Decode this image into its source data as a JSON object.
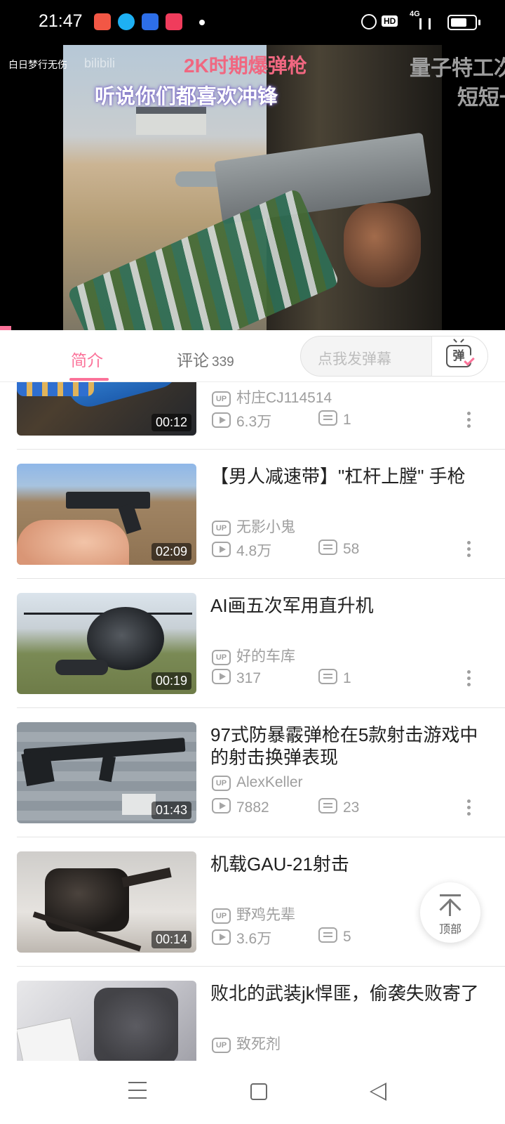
{
  "status_bar": {
    "time": "21:47",
    "network_label": "4G",
    "hd_label": "HD"
  },
  "player": {
    "caption_top": "2K时期爆弹枪",
    "caption_sub": "听说你们都喜欢冲锋",
    "danmaku_left": "白日梦行无伤",
    "watermark": "bilibili",
    "danmaku_right_1": "量子特工次",
    "danmaku_right_2": "短短一"
  },
  "tabs": {
    "intro": "简介",
    "comments": "评论",
    "comments_count": "339",
    "danmaku_placeholder": "点我发弹幕",
    "danmaku_button": "弹"
  },
  "videos": [
    {
      "title": "",
      "uploader": "村庄CJ114514",
      "views": "6.3万",
      "danmaku": "1",
      "duration": "00:12"
    },
    {
      "title": "【男人减速带】\"杠杆上膛\" 手枪",
      "uploader": "无影小鬼",
      "views": "4.8万",
      "danmaku": "58",
      "duration": "02:09"
    },
    {
      "title": "AI画五次军用直升机",
      "uploader": "好的车库",
      "views": "317",
      "danmaku": "1",
      "duration": "00:19"
    },
    {
      "title": "97式防暴霰弹枪在5款射击游戏中的射击换弹表现",
      "uploader": "AlexKeller",
      "views": "7882",
      "danmaku": "23",
      "duration": "01:43"
    },
    {
      "title": "机载GAU-21射击",
      "uploader": "野鸡先辈",
      "views": "3.6万",
      "danmaku": "5",
      "duration": "00:14"
    },
    {
      "title": "败北的武装jk悍匪，偷袭失败寄了",
      "uploader": "致死剂",
      "views": "",
      "danmaku": "",
      "duration": ""
    }
  ],
  "labels": {
    "up_badge": "UP",
    "back_to_top": "顶部"
  },
  "colors": {
    "accent_pink": "#fb7299",
    "text_primary": "#212121",
    "text_secondary": "#9e9e9e"
  }
}
